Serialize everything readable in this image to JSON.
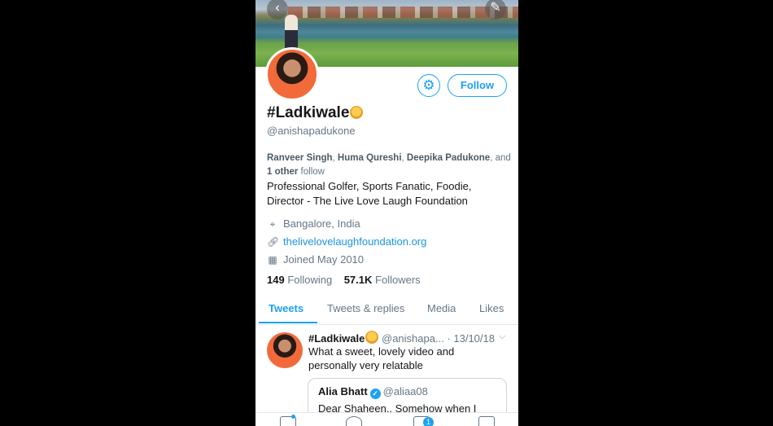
{
  "header": {
    "back_icon": "back-arrow-icon",
    "compose_icon": "compose-tweet-icon"
  },
  "profile": {
    "display_name": "#Ladkiwale",
    "handle": "@anishapadukone",
    "followed_by": {
      "names": [
        "Ranveer Singh",
        "Huma Qureshi",
        "Deepika Padukone"
      ],
      "and": ", and",
      "others": "1 other",
      "suffix": "follow"
    },
    "bio_line1": "Professional Golfer, Sports Fanatic, Foodie,",
    "bio_line2": "Director - The Live Love Laugh Foundation",
    "location": "Bangalore, India",
    "website": "thelivelovelaughfoundation.org",
    "joined": "Joined May 2010",
    "following_count": "149",
    "following_label": "Following",
    "followers_count": "57.1K",
    "followers_label": "Followers",
    "follow_label": "Follow"
  },
  "tabs": [
    "Tweets",
    "Tweets & replies",
    "Media",
    "Likes"
  ],
  "tweet": {
    "name": "#Ladkiwale",
    "handle": "@anishapa...",
    "date": "· 13/10/18",
    "line1": "What a sweet, lovely video and",
    "line2": "personally very relatable",
    "quote": {
      "name": "Alia Bhatt",
      "handle": "@aliaa08",
      "text": "Dear Shaheen.. Somehow when I"
    }
  },
  "bottom_nav": {
    "notifications_badge": "1"
  },
  "colors": {
    "accent": "#1da1f2",
    "link": "#1b95e0",
    "muted": "#657786",
    "text": "#14171a"
  }
}
